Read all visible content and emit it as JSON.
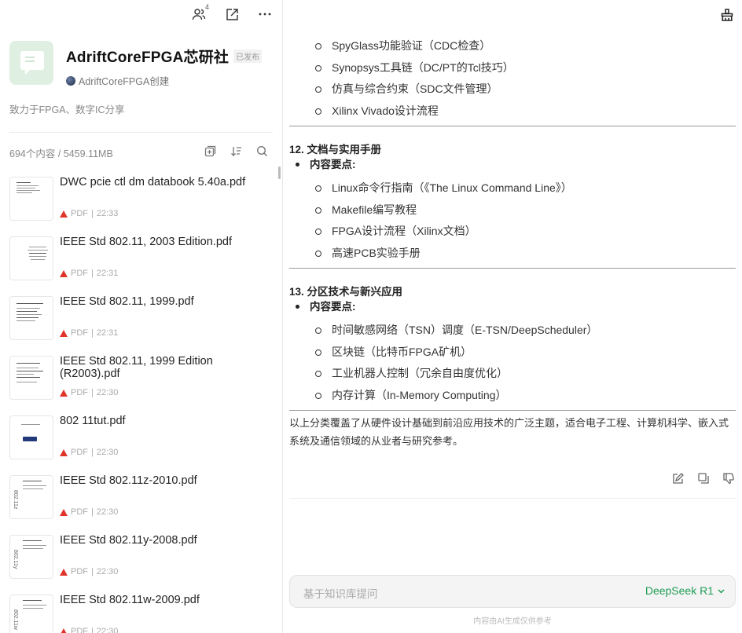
{
  "left_panel": {
    "top_icons": [
      {
        "icon": "members-icon",
        "badge": "4"
      },
      {
        "icon": "share-icon"
      },
      {
        "icon": "more-icon"
      }
    ],
    "kb": {
      "title": "AdriftCoreFPGA芯研社",
      "status": "已发布",
      "creator": "AdriftCoreFPGA创建",
      "description": "致力于FPGA、数字IC分享"
    },
    "stats": "694个内容 / 5459.11MB",
    "files": [
      {
        "name": " DWC pcie ctl dm databook 5.40a.pdf",
        "type": "PDF",
        "time": "22:33"
      },
      {
        "name": "IEEE Std 802.11, 2003 Edition.pdf",
        "type": "PDF",
        "time": "22:31"
      },
      {
        "name": "IEEE Std 802.11, 1999.pdf",
        "type": "PDF",
        "time": "22:31"
      },
      {
        "name": "IEEE Std 802.11, 1999 Edition (R2003).pdf",
        "type": "PDF",
        "time": "22:30"
      },
      {
        "name": "802 11tut.pdf",
        "type": "PDF",
        "time": "22:30"
      },
      {
        "name": "IEEE Std 802.11z-2010.pdf",
        "type": "PDF",
        "time": "22:30"
      },
      {
        "name": "IEEE Std 802.11y-2008.pdf",
        "type": "PDF",
        "time": "22:30"
      },
      {
        "name": "IEEE Std 802.11w-2009.pdf",
        "type": "PDF",
        "time": "22:30"
      }
    ],
    "thumb_vertical_labels": {
      "z": "802.11z",
      "y": "802.11y",
      "w": "802.11w"
    }
  },
  "right_panel": {
    "top_subitems": [
      "SpyGlass功能验证（CDC检查）",
      "Synopsys工具链（DC/PT的Tcl技巧）",
      "仿真与综合约束（SDC文件管理）",
      "Xilinx Vivado设计流程"
    ],
    "sections": [
      {
        "title": "12. 文档与实用手册",
        "key_label": "内容要点:",
        "items": [
          "Linux命令行指南（《The Linux Command Line》）",
          "Makefile编写教程",
          "FPGA设计流程（Xilinx文档）",
          "高速PCB实验手册"
        ]
      },
      {
        "title": "13. 分区技术与新兴应用",
        "key_label": "内容要点:",
        "items": [
          "时间敏感网络（TSN）调度（E-TSN/DeepScheduler）",
          "区块链（比特币FPGA矿机）",
          "工业机器人控制（冗余自由度优化）",
          "内存计算（In-Memory Computing）"
        ]
      }
    ],
    "summary": "以上分类覆盖了从硬件设计基础到前沿应用技术的广泛主题，适合电子工程、计算机科学、嵌入式系统及通信领域的从业者与研究参考。",
    "ask": {
      "placeholder": "基于知识库提问",
      "model": "DeepSeek R1"
    },
    "footnote": "内容由AI生成仅供参考"
  },
  "colors": {
    "accent_green": "#1f9d55",
    "pdf_red": "#e0342b"
  }
}
